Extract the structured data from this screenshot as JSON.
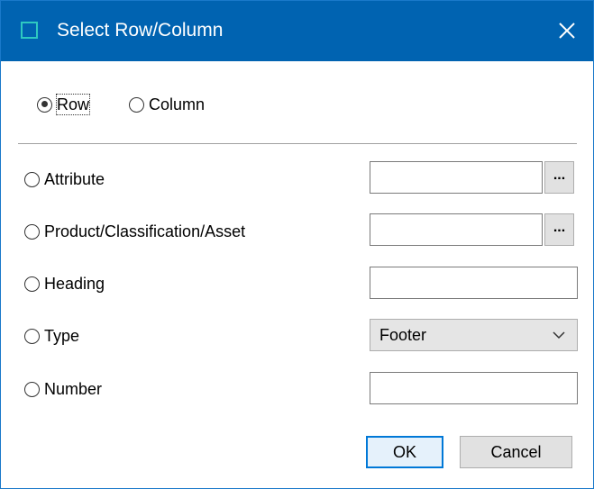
{
  "window": {
    "title": "Select Row/Column",
    "app_icon": "app-icon",
    "close_icon": "close-icon"
  },
  "orientation": {
    "selected": "row",
    "row_label": "Row",
    "column_label": "Column"
  },
  "options": {
    "selected": null,
    "attribute": {
      "label": "Attribute",
      "value": "",
      "browse_label": "..."
    },
    "product": {
      "label": "Product/Classification/Asset",
      "value": "",
      "browse_label": "..."
    },
    "heading": {
      "label": "Heading",
      "value": ""
    },
    "type": {
      "label": "Type",
      "value": "Footer",
      "dropdown_icon": "chevron-down-icon"
    },
    "number": {
      "label": "Number",
      "value": ""
    }
  },
  "buttons": {
    "ok": "OK",
    "cancel": "Cancel"
  },
  "colors": {
    "titlebar": "#0063b1",
    "window_border": "#1979ca",
    "app_icon": "#2ec9c1",
    "default_button_border": "#0078d7"
  }
}
